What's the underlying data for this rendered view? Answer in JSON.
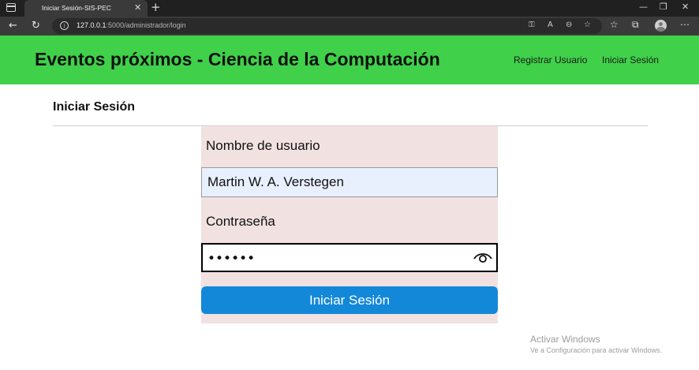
{
  "browser": {
    "tab_title": "Iniciar Sesión-SIS-PEC",
    "tab_close_icon": "close-icon",
    "new_tab_icon": "plus-icon",
    "url_host": "127.0.0.1",
    "url_path": ":5000/administrador/login",
    "window_controls": [
      "minimize-icon",
      "maximize-icon",
      "close-icon"
    ]
  },
  "navbar": {
    "brand": "Eventos próximos - Ciencia de la Computación",
    "links": [
      {
        "label": "Registrar Usuario"
      },
      {
        "label": "Iniciar Sesión"
      }
    ],
    "color": "#40d04a"
  },
  "page": {
    "heading": "Iniciar Sesión"
  },
  "form": {
    "username_label": "Nombre de usuario",
    "username_value": "Martin W. A. Verstegen",
    "password_label": "Contraseña",
    "password_masked": "••••••",
    "submit_label": "Iniciar Sesión",
    "panel_color": "#f1e2e1",
    "button_color": "#1388d8"
  },
  "watermark": {
    "line1": "Activar Windows",
    "line2": "Ve a Configuración para activar Windows."
  }
}
